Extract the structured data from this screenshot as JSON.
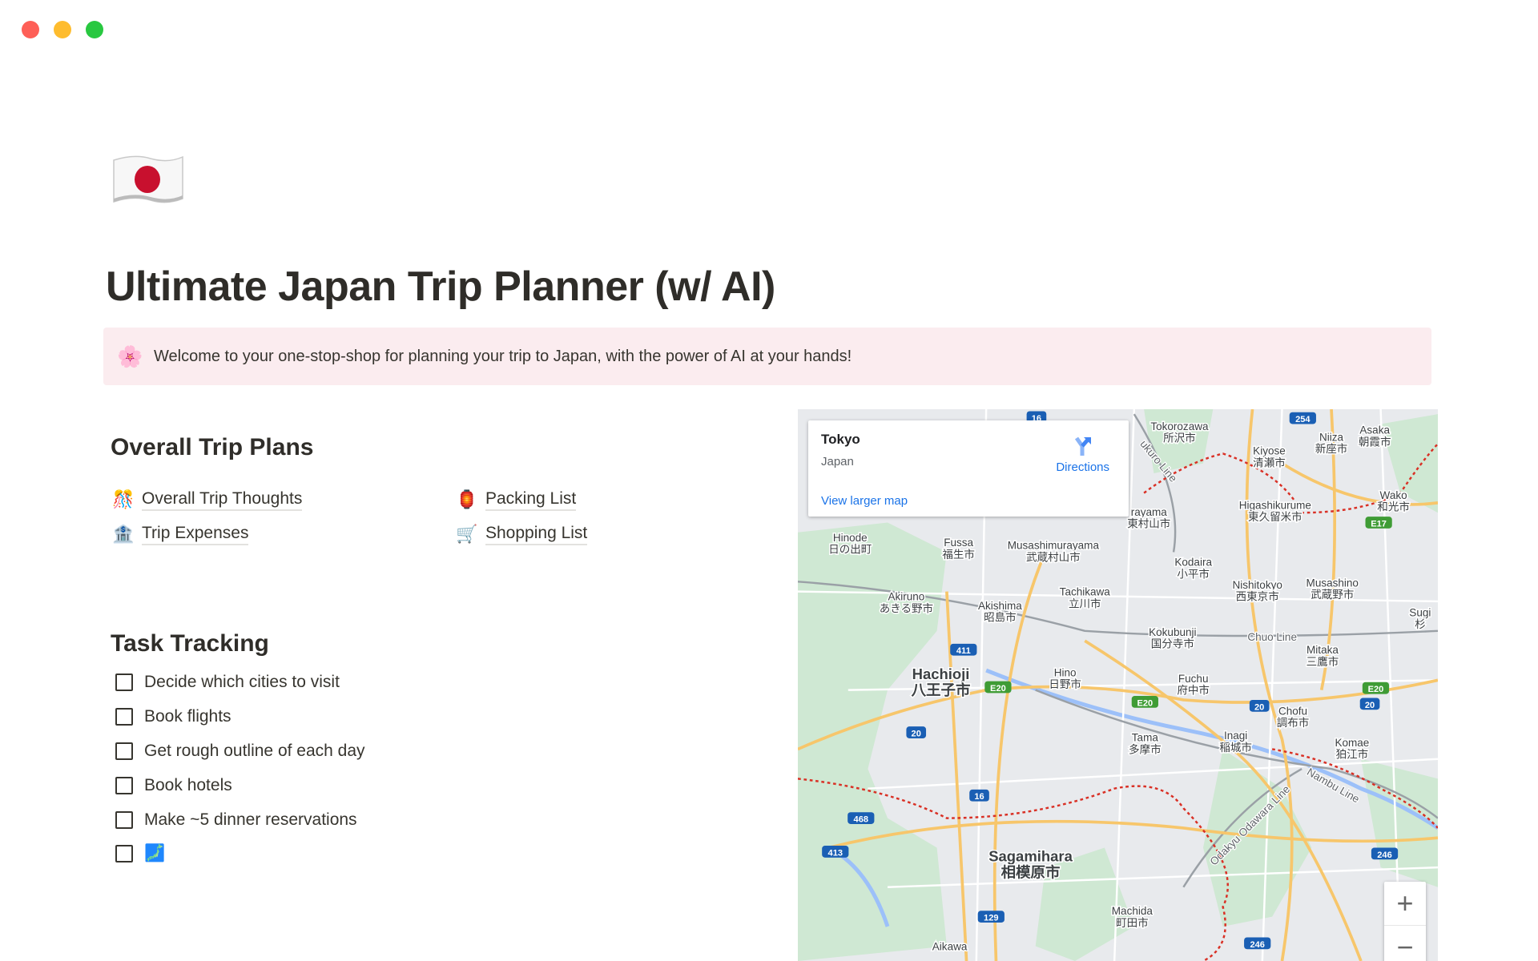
{
  "window": {
    "controls": [
      "close",
      "minimize",
      "maximize"
    ],
    "colors": {
      "close": "#fe5f57",
      "minimize": "#febc2e",
      "maximize": "#28c840"
    }
  },
  "page": {
    "icon": "japan-flag",
    "title": "Ultimate Japan Trip Planner (w/ AI)",
    "callout": {
      "emoji": "🌸",
      "text": "Welcome to your one-stop-shop for planning your trip to Japan, with the power of AI at your hands!",
      "bg": "#fbecef"
    }
  },
  "plans": {
    "heading": "Overall Trip Plans",
    "links": [
      {
        "emoji": "🎊",
        "label": "Overall Trip Thoughts"
      },
      {
        "emoji": "🏦",
        "label": "Trip Expenses"
      },
      {
        "emoji": "🏮",
        "label": "Packing List"
      },
      {
        "emoji": "🛒",
        "label": "Shopping List"
      }
    ]
  },
  "tasks": {
    "heading": "Task Tracking",
    "items": [
      {
        "label": "Decide which cities to visit",
        "checked": false
      },
      {
        "label": "Book flights",
        "checked": false
      },
      {
        "label": "Get rough outline of each day",
        "checked": false
      },
      {
        "label": "Book hotels",
        "checked": false
      },
      {
        "label": "Make ~5 dinner reservations",
        "checked": false
      },
      {
        "label": "🗾",
        "checked": false
      }
    ]
  },
  "map": {
    "card": {
      "name": "Tokyo",
      "sub": "Japan",
      "directions": "Directions",
      "larger": "View larger map"
    },
    "zoom_in": "+",
    "zoom_out": "−",
    "labels": [
      {
        "en": "Tokorozawa",
        "ja": "所沢市"
      },
      {
        "en": "Niiza",
        "ja": "新座市"
      },
      {
        "en": "Asaka",
        "ja": "朝霞市"
      },
      {
        "en": "Kiyose",
        "ja": "清瀬市"
      },
      {
        "en": "Higashikurume",
        "ja": "東久留米市"
      },
      {
        "en": "Wako",
        "ja": "和光市"
      },
      {
        "en": "rayama",
        "ja": "東村山市"
      },
      {
        "en": "Hinode",
        "ja": "日の出町"
      },
      {
        "en": "Fussa",
        "ja": "福生市"
      },
      {
        "en": "Musashimurayama",
        "ja": "武蔵村山市"
      },
      {
        "en": "Kodaira",
        "ja": "小平市"
      },
      {
        "en": "Nishitokyo",
        "ja": "西東京市"
      },
      {
        "en": "Musashino",
        "ja": "武蔵野市"
      },
      {
        "en": "Akiruno",
        "ja": "あきる野市"
      },
      {
        "en": "Akishima",
        "ja": "昭島市"
      },
      {
        "en": "Tachikawa",
        "ja": "立川市"
      },
      {
        "en": "Kokubunji",
        "ja": "国分寺市"
      },
      {
        "en": "Sugi",
        "ja": "杉"
      },
      {
        "en": "Mitaka",
        "ja": "三鷹市"
      },
      {
        "en": "Hachioji",
        "ja": "八王子市"
      },
      {
        "en": "Hino",
        "ja": "日野市"
      },
      {
        "en": "Fuchu",
        "ja": "府中市"
      },
      {
        "en": "Chofu",
        "ja": "調布市"
      },
      {
        "en": "Tama",
        "ja": "多摩市"
      },
      {
        "en": "Inagi",
        "ja": "稲城市"
      },
      {
        "en": "Komae",
        "ja": "狛江市"
      },
      {
        "en": "Sagamihara",
        "ja": "相模原市"
      },
      {
        "en": "Machida",
        "ja": "町田市"
      },
      {
        "en": "Aikawa",
        "ja": ""
      }
    ],
    "lines": [
      "Chuo Line",
      "Nambu Line",
      "Odakyu Odawara Line",
      "ukuro Line"
    ],
    "shields": [
      {
        "text": "16",
        "type": "national"
      },
      {
        "text": "254",
        "type": "national"
      },
      {
        "text": "E17",
        "type": "expressway"
      },
      {
        "text": "411",
        "type": "national"
      },
      {
        "text": "E20",
        "type": "expressway"
      },
      {
        "text": "20",
        "type": "national"
      },
      {
        "text": "E20",
        "type": "expressway"
      },
      {
        "text": "20",
        "type": "national"
      },
      {
        "text": "20",
        "type": "national"
      },
      {
        "text": "E20",
        "type": "expressway"
      },
      {
        "text": "16",
        "type": "national"
      },
      {
        "text": "468",
        "type": "national"
      },
      {
        "text": "413",
        "type": "national"
      },
      {
        "text": "129",
        "type": "national"
      },
      {
        "text": "246",
        "type": "national"
      },
      {
        "text": "246",
        "type": "national"
      }
    ]
  }
}
